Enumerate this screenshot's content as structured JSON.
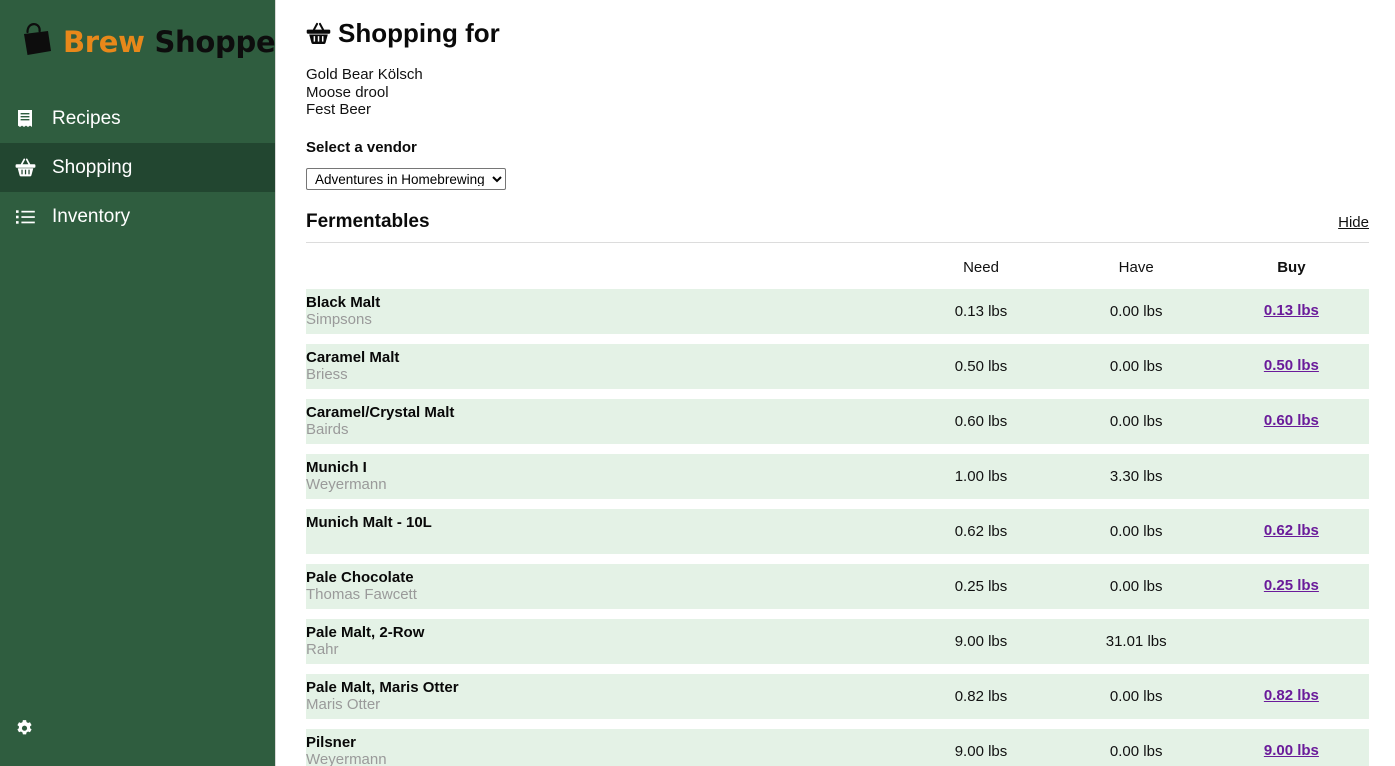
{
  "brand": {
    "word1": "Brew",
    "word2": "Shopper",
    "icon": "shopping-bag-icon"
  },
  "sidebar": {
    "background_color": "#2f5d3f",
    "active_background_color": "#224630",
    "items": [
      {
        "label": "Recipes",
        "icon": "receipt-icon",
        "active": false
      },
      {
        "label": "Shopping",
        "icon": "basket-icon",
        "active": true
      },
      {
        "label": "Inventory",
        "icon": "list-ul-icon",
        "active": false
      }
    ],
    "settings_icon": "gear-icon"
  },
  "main": {
    "title": "Shopping for",
    "title_icon": "basket-icon",
    "recipes": [
      "Gold Bear Kölsch",
      "Moose drool",
      "Fest Beer"
    ],
    "vendor": {
      "label": "Select a vendor",
      "selected": "Adventures in Homebrewing",
      "options": [
        "Adventures in Homebrewing"
      ]
    },
    "section": {
      "title": "Fermentables",
      "toggle_label": "Hide"
    },
    "table": {
      "columns": [
        "",
        "Need",
        "Have",
        "Buy"
      ],
      "row_background_color": "#e4f2e6",
      "buy_link_color": "#6a1b9a",
      "rows": [
        {
          "name": "Black Malt",
          "supplier": "Simpsons",
          "need": "0.13 lbs",
          "have": "0.00 lbs",
          "buy": "0.13 lbs"
        },
        {
          "name": "Caramel Malt",
          "supplier": "Briess",
          "need": "0.50 lbs",
          "have": "0.00 lbs",
          "buy": "0.50 lbs"
        },
        {
          "name": "Caramel/Crystal Malt",
          "supplier": "Bairds",
          "need": "0.60 lbs",
          "have": "0.00 lbs",
          "buy": "0.60 lbs"
        },
        {
          "name": "Munich I",
          "supplier": "Weyermann",
          "need": "1.00 lbs",
          "have": "3.30 lbs",
          "buy": ""
        },
        {
          "name": "Munich Malt - 10L",
          "supplier": "",
          "need": "0.62 lbs",
          "have": "0.00 lbs",
          "buy": "0.62 lbs"
        },
        {
          "name": "Pale Chocolate",
          "supplier": "Thomas Fawcett",
          "need": "0.25 lbs",
          "have": "0.00 lbs",
          "buy": "0.25 lbs"
        },
        {
          "name": "Pale Malt, 2-Row",
          "supplier": "Rahr",
          "need": "9.00 lbs",
          "have": "31.01 lbs",
          "buy": ""
        },
        {
          "name": "Pale Malt, Maris Otter",
          "supplier": "Maris Otter",
          "need": "0.82 lbs",
          "have": "0.00 lbs",
          "buy": "0.82 lbs"
        },
        {
          "name": "Pilsner",
          "supplier": "Weyermann",
          "need": "9.00 lbs",
          "have": "0.00 lbs",
          "buy": "9.00 lbs"
        }
      ]
    }
  }
}
